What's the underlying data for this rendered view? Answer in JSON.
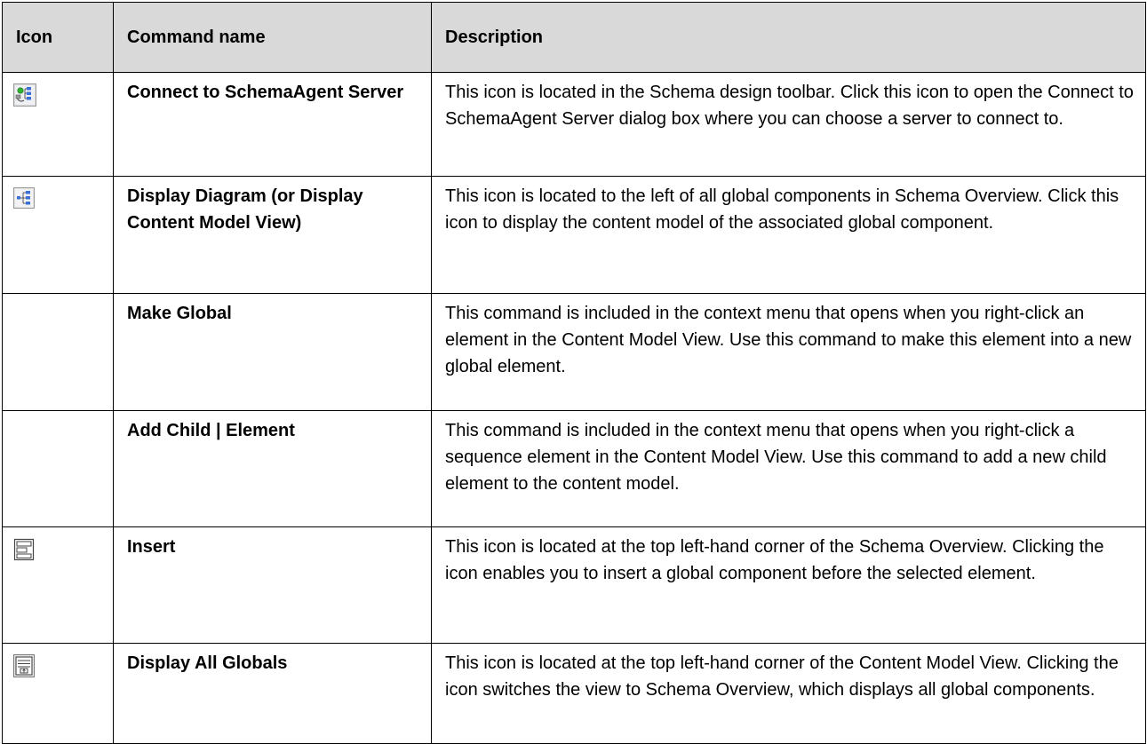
{
  "table": {
    "headers": {
      "icon": "Icon",
      "command": "Command name",
      "description": "Description"
    },
    "rows": [
      {
        "icon": "connect-server-icon",
        "name": "Connect to SchemaAgent Server",
        "description": "This icon is located in the Schema design toolbar. Click this icon to open the Connect to SchemaAgent Server dialog box where you can choose a server to connect to."
      },
      {
        "icon": "display-diagram-icon",
        "name": "Display Diagram (or Display Content Model View)",
        "description": "This icon is located to the left of all global components in Schema Overview. Click this icon to display the content model of the associated global component."
      },
      {
        "icon": "",
        "name": "Make Global",
        "description": "This command is included in the context menu that opens when you right-click an element in the Content Model View. Use this command to make this element into a new global element."
      },
      {
        "icon": "",
        "name": "Add Child | Element",
        "description": "This command is included in the context menu that opens when you right-click a sequence element in the Content Model View. Use this command to add a new child element to the content model."
      },
      {
        "icon": "insert-icon",
        "name": "Insert",
        "description": "This icon is located at the top left-hand corner of the Schema Overview. Clicking the icon enables you to insert a global component before the selected element."
      },
      {
        "icon": "display-all-globals-icon",
        "name": "Display All Globals",
        "description": "This icon is located at the top left-hand corner of the Content Model View. Clicking the icon switches the view to Schema Overview, which displays all global components."
      }
    ]
  }
}
